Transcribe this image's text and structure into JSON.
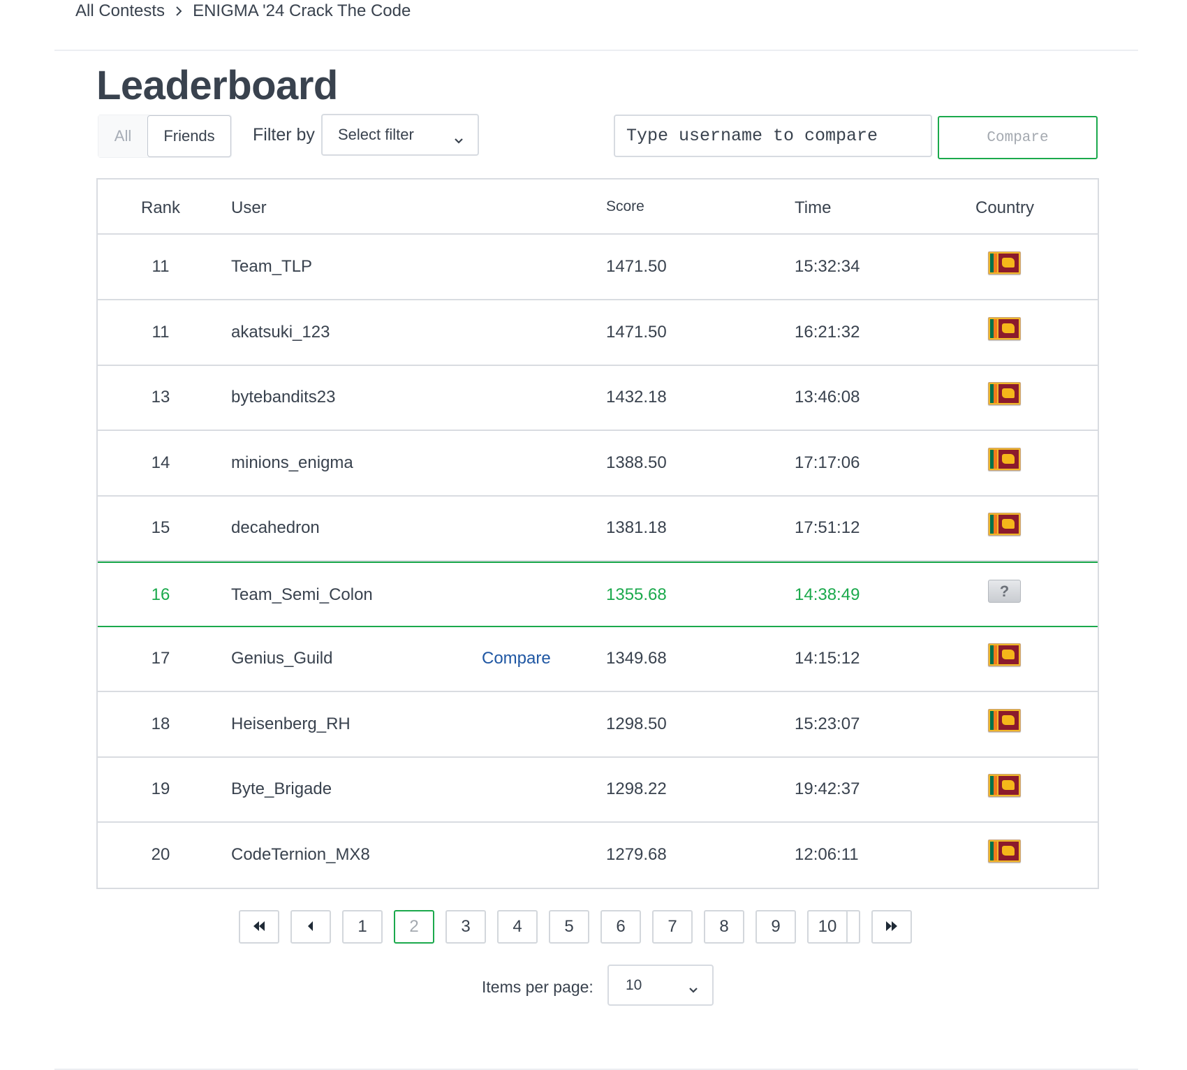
{
  "breadcrumb": {
    "items": [
      "All Contests",
      "ENIGMA '24 Crack The Code"
    ]
  },
  "page": {
    "title": "Leaderboard"
  },
  "toolbar": {
    "toggle_all": "All",
    "toggle_friends": "Friends",
    "filter_label": "Filter by",
    "filter_value": "Select filter",
    "compare_placeholder": "Type username to compare",
    "compare_button": "Compare"
  },
  "table": {
    "headers": {
      "rank": "Rank",
      "user": "User",
      "score": "Score",
      "time": "Time",
      "country": "Country"
    },
    "rows": [
      {
        "rank": "11",
        "user": "Team_TLP",
        "score": "1471.50",
        "time": "15:32:34",
        "country": "sri-lanka-flag",
        "compare": ""
      },
      {
        "rank": "11",
        "user": "akatsuki_123",
        "score": "1471.50",
        "time": "16:21:32",
        "country": "sri-lanka-flag",
        "compare": ""
      },
      {
        "rank": "13",
        "user": "bytebandits23",
        "score": "1432.18",
        "time": "13:46:08",
        "country": "sri-lanka-flag",
        "compare": ""
      },
      {
        "rank": "14",
        "user": "minions_enigma",
        "score": "1388.50",
        "time": "17:17:06",
        "country": "sri-lanka-flag",
        "compare": ""
      },
      {
        "rank": "15",
        "user": "decahedron",
        "score": "1381.18",
        "time": "17:51:12",
        "country": "sri-lanka-flag",
        "compare": ""
      },
      {
        "rank": "16",
        "user": "Team_Semi_Colon",
        "score": "1355.68",
        "time": "14:38:49",
        "country": "unknown-flag",
        "compare": "",
        "highlight": true,
        "unknown_flag_text": "?"
      },
      {
        "rank": "17",
        "user": "Genius_Guild",
        "score": "1349.68",
        "time": "14:15:12",
        "country": "sri-lanka-flag",
        "compare": "Compare"
      },
      {
        "rank": "18",
        "user": "Heisenberg_RH",
        "score": "1298.50",
        "time": "15:23:07",
        "country": "sri-lanka-flag",
        "compare": ""
      },
      {
        "rank": "19",
        "user": "Byte_Brigade",
        "score": "1298.22",
        "time": "19:42:37",
        "country": "sri-lanka-flag",
        "compare": ""
      },
      {
        "rank": "20",
        "user": "CodeTernion_MX8",
        "score": "1279.68",
        "time": "12:06:11",
        "country": "sri-lanka-flag",
        "compare": ""
      }
    ]
  },
  "pagination": {
    "pages": [
      "1",
      "2",
      "3",
      "4",
      "5",
      "6",
      "7",
      "8",
      "9",
      "10"
    ],
    "current": "2",
    "first_icon": "double-chevron-left-icon",
    "prev_icon": "caret-left-icon",
    "next_icon": "caret-right-icon",
    "last_icon": "double-chevron-right-icon"
  },
  "items_per_page": {
    "label": "Items per page:",
    "value": "10"
  },
  "colors": {
    "accent_green": "#1ba94c",
    "text": "#39424e",
    "link_blue": "#1f57a3",
    "border": "#d9dce1"
  }
}
